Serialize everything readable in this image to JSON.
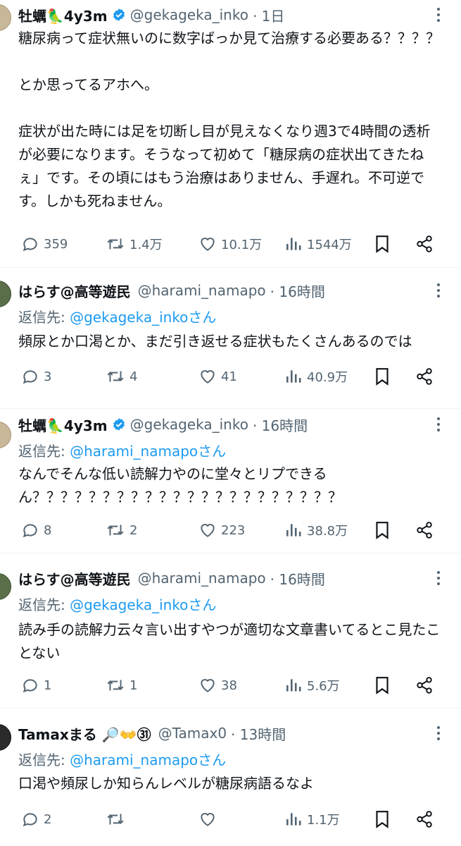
{
  "tweets": [
    {
      "name": "牡蠣🦜4y3m",
      "verified": true,
      "handle": "@gekageka_inko",
      "time": "· 1日",
      "reply_prefix": "",
      "reply_to": "",
      "body": "糖尿病って症状無いのに数字ばっか見て治療する必要ある？？？？\n\nとか思ってるアホへ。\n\n症状が出た時には足を切断し目が見えなくなり週3で4時間の透析が必要になります。そうなって初めて「糖尿病の症状出てきたねぇ」です。その頃にはもう治療はありません、手遅れ。不可逆です。しかも死ねません。",
      "replies": "359",
      "retweets": "1.4万",
      "likes": "10.1万",
      "views": "1544万"
    },
    {
      "name": "はらす@高等遊民",
      "verified": false,
      "handle": "@harami_namapo",
      "time": "· 16時間",
      "reply_prefix": "返信先: ",
      "reply_to": "@gekageka_inkoさん",
      "body": "頻尿とか口渇とか、まだ引き返せる症状もたくさんあるのでは",
      "replies": "3",
      "retweets": "4",
      "likes": "41",
      "views": "40.9万"
    },
    {
      "name": "牡蠣🦜4y3m",
      "verified": true,
      "handle": "@gekageka_inko",
      "time": "· 16時間",
      "reply_prefix": "返信先: ",
      "reply_to": "@harami_namapoさん",
      "body": "なんでそんな低い読解力やのに堂々とリプできるん？？？？？？？？？？？？？？？？？？？？？？",
      "replies": "8",
      "retweets": "2",
      "likes": "223",
      "views": "38.8万"
    },
    {
      "name": "はらす@高等遊民",
      "verified": false,
      "handle": "@harami_namapo",
      "time": "· 16時間",
      "reply_prefix": "返信先: ",
      "reply_to": "@gekageka_inkoさん",
      "body": "読み手の読解力云々言い出すやつが適切な文章書いてるとこ見たことない",
      "replies": "1",
      "retweets": "1",
      "likes": "38",
      "views": "5.6万"
    },
    {
      "name": "Tamaxまる 🔎👐㉛",
      "verified": false,
      "handle": "@Tamax0",
      "time": "· 13時間",
      "reply_prefix": "返信先: ",
      "reply_to": "@harami_namapoさん",
      "body": "口渇や頻尿しか知らんレベルが糖尿病語るなよ",
      "replies": "2",
      "retweets": "",
      "likes": "",
      "views": "1.1万"
    }
  ],
  "icons": [
    "more-icon",
    "verified-icon",
    "reply-icon",
    "retweet-icon",
    "like-icon",
    "views-icon",
    "bookmark-icon",
    "share-icon"
  ],
  "colors": {
    "text": "#0f1419",
    "secondary": "#536471",
    "link": "#1d9bf0",
    "verified": "#1d9bf0"
  }
}
